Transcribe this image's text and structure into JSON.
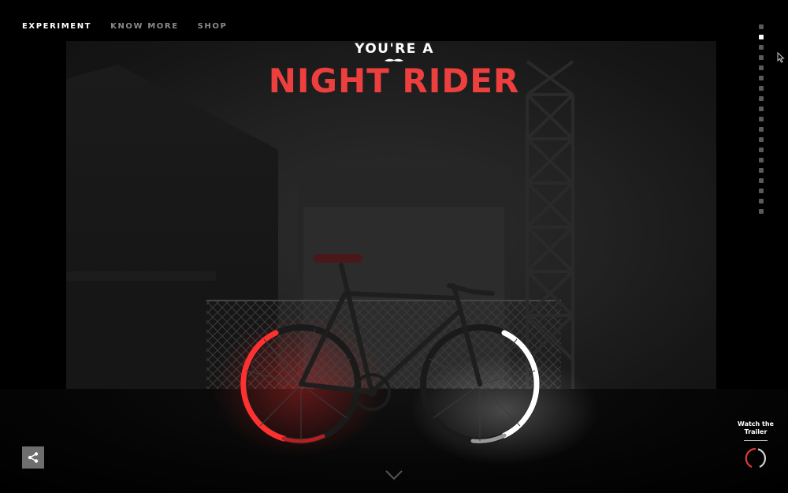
{
  "nav": {
    "items": [
      {
        "label": "EXPERIMENT",
        "active": true
      },
      {
        "label": "KNOW MORE",
        "active": false
      },
      {
        "label": "SHOP",
        "active": false
      }
    ]
  },
  "headline": {
    "subtitle": "YOU'RE A",
    "title": "NIGHT RIDER"
  },
  "section_dots": {
    "count": 19,
    "active_index": 1
  },
  "trailer": {
    "label_line1": "Watch the",
    "label_line2": "Trailer"
  },
  "colors": {
    "accent_red": "#ee3f3f",
    "background": "#000000",
    "dot_inactive": "#5a5a5a"
  },
  "icons": {
    "share": "share-icon",
    "scroll": "chevron-down-icon",
    "trailer": "play-ring-icon"
  }
}
